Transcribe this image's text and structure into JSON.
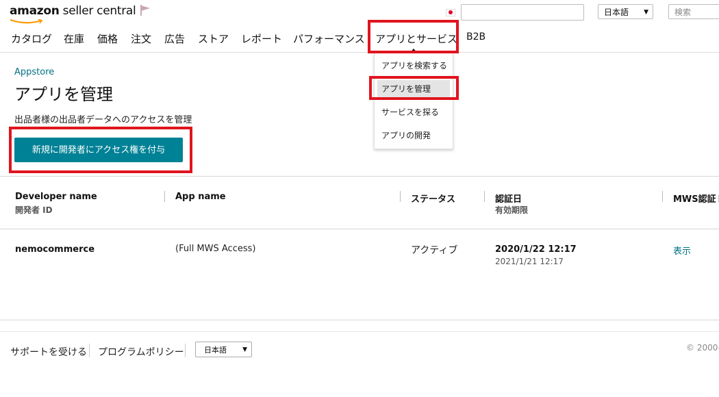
{
  "header": {
    "logo_brand": "amazon",
    "logo_product": "seller central",
    "language_select": "日本語",
    "help_search_placeholder": "検索"
  },
  "nav": {
    "items": [
      "カタログ",
      "在庫",
      "価格",
      "注文",
      "広告",
      "ストア",
      "レポート",
      "パフォーマンス",
      "アプリとサービス",
      "B2B"
    ],
    "active_item": "アプリとサービス"
  },
  "dropdown": {
    "items": [
      "アプリを検索する",
      "アプリを管理",
      "サービスを探る",
      "アプリの開発"
    ],
    "selected": "アプリを管理"
  },
  "page": {
    "breadcrumb": "Appstore",
    "title": "アプリを管理",
    "description": "出品者様の出品者データへのアクセスを管理",
    "grant_button": "新規に開発者にアクセス権を付与"
  },
  "table": {
    "headers": {
      "developer_name": "Developer name",
      "developer_id": "開発者 ID",
      "app_name": "App name",
      "status": "ステータス",
      "auth_date": "認証日",
      "expiry": "有効期限",
      "mws_token": "MWS認証ト"
    },
    "rows": [
      {
        "developer_name": "nemocommerce",
        "app_name": "(Full MWS Access)",
        "status": "アクティブ",
        "auth_date": "2020/1/22 12:17",
        "expiry": "2021/1/21 12:17",
        "mws_action": "表示"
      }
    ]
  },
  "footer": {
    "support_link": "サポートを受ける",
    "policy_link": "プログラムポリシー",
    "language_select": "日本語",
    "copyright": "© 2000-"
  },
  "icons": {
    "flag": "flag-icon",
    "japan_flag": "japan-flag-icon",
    "caret": "chevron-down-icon"
  },
  "colors": {
    "accent": "#008296",
    "link": "#007185",
    "highlight": "#e0141e",
    "logo_smile": "#ff9900"
  }
}
